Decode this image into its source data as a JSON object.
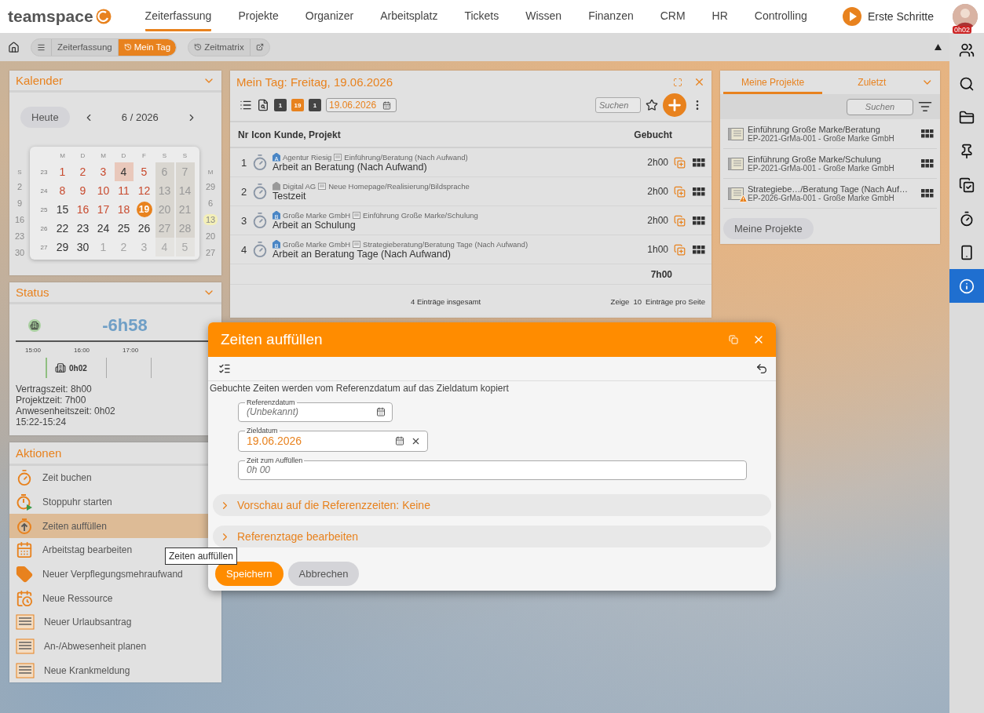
{
  "app": {
    "logo": "teamspace"
  },
  "nav": {
    "items": [
      {
        "label": "Zeiterfassung",
        "selected": true
      },
      {
        "label": "Projekte",
        "selected": false
      },
      {
        "label": "Organizer",
        "selected": false
      },
      {
        "label": "Arbeitsplatz",
        "selected": false
      },
      {
        "label": "Tickets",
        "selected": false
      },
      {
        "label": "Wissen",
        "selected": false
      },
      {
        "label": "Finanzen",
        "selected": false
      },
      {
        "label": "CRM",
        "selected": false
      },
      {
        "label": "HR",
        "selected": false
      },
      {
        "label": "Controlling",
        "selected": false
      }
    ],
    "start": "Erste Schritte",
    "user_badge": "0h02"
  },
  "breadcrumb": {
    "items": [
      {
        "label": "Zeiterfassung",
        "selected": false
      },
      {
        "label": "Mein Tag",
        "selected": true
      }
    ],
    "extra": "Zeitmatrix"
  },
  "calendar": {
    "title": "Kalender",
    "today_button": "Heute",
    "month": "6 / 2026",
    "weekdays": [
      "M",
      "D",
      "M",
      "D",
      "F",
      "S",
      "S"
    ],
    "weeks": [
      {
        "week": "23",
        "days": [
          {
            "day": "1",
            "kind": "missing"
          },
          {
            "day": "2",
            "kind": "missing"
          },
          {
            "day": "3",
            "kind": "missing"
          },
          {
            "day": "4",
            "kind": "holiday"
          },
          {
            "day": "5",
            "kind": "missing"
          },
          {
            "day": "6",
            "kind": "weekend"
          },
          {
            "day": "7",
            "kind": "weekend"
          }
        ]
      },
      {
        "week": "24",
        "days": [
          {
            "day": "8",
            "kind": "missing"
          },
          {
            "day": "9",
            "kind": "missing"
          },
          {
            "day": "10",
            "kind": "missing"
          },
          {
            "day": "11",
            "kind": "missing"
          },
          {
            "day": "12",
            "kind": "missing"
          },
          {
            "day": "13",
            "kind": "weekend"
          },
          {
            "day": "14",
            "kind": "weekend"
          }
        ]
      },
      {
        "week": "25",
        "days": [
          {
            "day": "15",
            "kind": "booked"
          },
          {
            "day": "16",
            "kind": "missing"
          },
          {
            "day": "17",
            "kind": "missing"
          },
          {
            "day": "18",
            "kind": "missing"
          },
          {
            "day": "19",
            "kind": "selected"
          },
          {
            "day": "20",
            "kind": "weekend"
          },
          {
            "day": "21",
            "kind": "weekend"
          }
        ]
      },
      {
        "week": "26",
        "days": [
          {
            "day": "22",
            "kind": "booked"
          },
          {
            "day": "23",
            "kind": "booked"
          },
          {
            "day": "24",
            "kind": "booked"
          },
          {
            "day": "25",
            "kind": "booked"
          },
          {
            "day": "26",
            "kind": "booked"
          },
          {
            "day": "27",
            "kind": "weekend"
          },
          {
            "day": "28",
            "kind": "weekend"
          }
        ]
      },
      {
        "week": "27",
        "days": [
          {
            "day": "29",
            "kind": "booked"
          },
          {
            "day": "30",
            "kind": "booked"
          },
          {
            "day": "1",
            "kind": "outside"
          },
          {
            "day": "2",
            "kind": "outside"
          },
          {
            "day": "3",
            "kind": "outside"
          },
          {
            "day": "4",
            "kind": "weekend_outside"
          },
          {
            "day": "5",
            "kind": "weekend_outside"
          }
        ]
      }
    ],
    "peek_left": {
      "header": "S",
      "days": [
        "2",
        "9",
        "16",
        "23",
        "30"
      ]
    },
    "peek_right": {
      "header": "M",
      "days": [
        {
          "day": "29",
          "marked": false
        },
        {
          "day": "6",
          "marked": false
        },
        {
          "day": "13",
          "marked": true
        },
        {
          "day": "20",
          "marked": false
        },
        {
          "day": "27",
          "marked": false
        }
      ]
    }
  },
  "status": {
    "title": "Status",
    "balance": "-6h58",
    "hours": [
      "15:00",
      "16:00",
      "17:00"
    ],
    "presence": "0h02",
    "lines": [
      "Vertragszeit: 8h00",
      "Projektzeit: 7h00",
      "Anwesenheitszeit: 0h02",
      "15:22-15:24"
    ]
  },
  "actions": {
    "title": "Aktionen",
    "items": [
      {
        "label": "Zeit buchen",
        "kind": "stopwatch",
        "selected": false
      },
      {
        "label": "Stoppuhr starten",
        "kind": "stopwatch_play",
        "selected": false
      },
      {
        "label": "Zeiten auffüllen",
        "kind": "stopwatch_up",
        "selected": true
      },
      {
        "label": "Arbeitstag bearbeiten",
        "kind": "calendar",
        "selected": false
      },
      {
        "label": "Neuer Verpflegungsmehraufwand",
        "kind": "tag",
        "selected": false
      },
      {
        "label": "Neue Ressource",
        "kind": "calendar_clock",
        "selected": false
      },
      {
        "label": "Neuer Urlaubsantrag",
        "kind": "form",
        "selected": false
      },
      {
        "label": "An-/Abwesenheit planen",
        "kind": "form",
        "selected": false
      },
      {
        "label": "Neue Krankmeldung",
        "kind": "form",
        "selected": false
      }
    ]
  },
  "tooltip": "Zeiten auffüllen",
  "day_view": {
    "title": "Mein Tag: Freitag, 19.06.2026",
    "views": [
      {
        "label": "1",
        "selected": false
      },
      {
        "label": "19",
        "selected": true
      },
      {
        "label": "1",
        "selected": false
      }
    ],
    "date": "19.06.2026",
    "search_placeholder": "Suchen",
    "columns": [
      "Nr",
      "Icon",
      "Kunde, Projekt",
      "Gebucht"
    ],
    "rows": [
      {
        "nr": "1",
        "badge": "A",
        "customer": "Agentur Riesig",
        "project": "Einführung/Beratung (Nach Aufwand)",
        "title": "Arbeit an Beratung (Nach Aufwand)",
        "booked": "2h00"
      },
      {
        "nr": "2",
        "customer": "Digital AG",
        "project": "Neue Homepage/Realisierung/Bildsprache",
        "title": "Testzeit",
        "booked": "2h00"
      },
      {
        "nr": "3",
        "badge": "B",
        "customer": "Große Marke GmbH",
        "project": "Einführung Große Marke/Schulung",
        "title": "Arbeit an Schulung",
        "booked": "2h00"
      },
      {
        "nr": "4",
        "badge": "B",
        "customer": "Große Marke GmbH",
        "project": "Strategieberatung/Beratung Tage (Nach Aufwand)",
        "title": "Arbeit an Beratung Tage (Nach Aufwand)",
        "booked": "1h00"
      }
    ],
    "total": "7h00",
    "count": "4 Einträge insgesamt",
    "show": "Zeige",
    "page_size": "10",
    "per_page": "Einträge pro Seite"
  },
  "projects": {
    "tabs": [
      {
        "label": "Meine Projekte",
        "selected": true
      },
      {
        "label": "Zuletzt",
        "selected": false
      }
    ],
    "search_placeholder": "Suchen",
    "items": [
      {
        "title": "Einführung Große Marke/Beratung",
        "subtitle": "EP-2021-GrMa-001 - Große Marke GmbH",
        "warning": false
      },
      {
        "title": "Einführung Große Marke/Schulung",
        "subtitle": "EP-2021-GrMa-001 - Große Marke GmbH",
        "warning": false
      },
      {
        "title": "Strategiebe…/Beratung Tage (Nach Auf…",
        "subtitle": "EP-2026-GrMa-001 - Große Marke GmbH",
        "warning": true
      }
    ],
    "button": "Meine Projekte"
  },
  "dialog": {
    "title": "Zeiten auffüllen",
    "description": "Gebuchte Zeiten werden vom Referenzdatum auf das Zieldatum kopiert",
    "fields": [
      {
        "label": "Referenzdatum",
        "placeholder": "(Unbekannt)",
        "kind": "date"
      },
      {
        "label": "Zieldatum",
        "value": "19.06.2026",
        "kind": "date_clearable"
      },
      {
        "label": "Zeit zum Auffüllen",
        "placeholder": "0h 00",
        "kind": "text"
      }
    ],
    "sections": [
      {
        "label": "Vorschau auf die Referenzzeiten: Keine",
        "expanded": false
      },
      {
        "label": "Referenztage bearbeiten",
        "expanded": false
      }
    ],
    "buttons": [
      {
        "label": "Speichern",
        "kind": "primary"
      },
      {
        "label": "Abbrechen",
        "kind": "secondary"
      }
    ]
  },
  "sidebar": {
    "items": [
      {
        "kind": "people",
        "selected": false
      },
      {
        "kind": "search",
        "selected": false
      },
      {
        "kind": "folder",
        "selected": false
      },
      {
        "kind": "pin",
        "selected": false
      },
      {
        "kind": "checklist",
        "selected": false
      },
      {
        "kind": "stopwatch",
        "selected": false
      },
      {
        "kind": "phone",
        "selected": false
      },
      {
        "kind": "info",
        "selected": true
      }
    ]
  }
}
